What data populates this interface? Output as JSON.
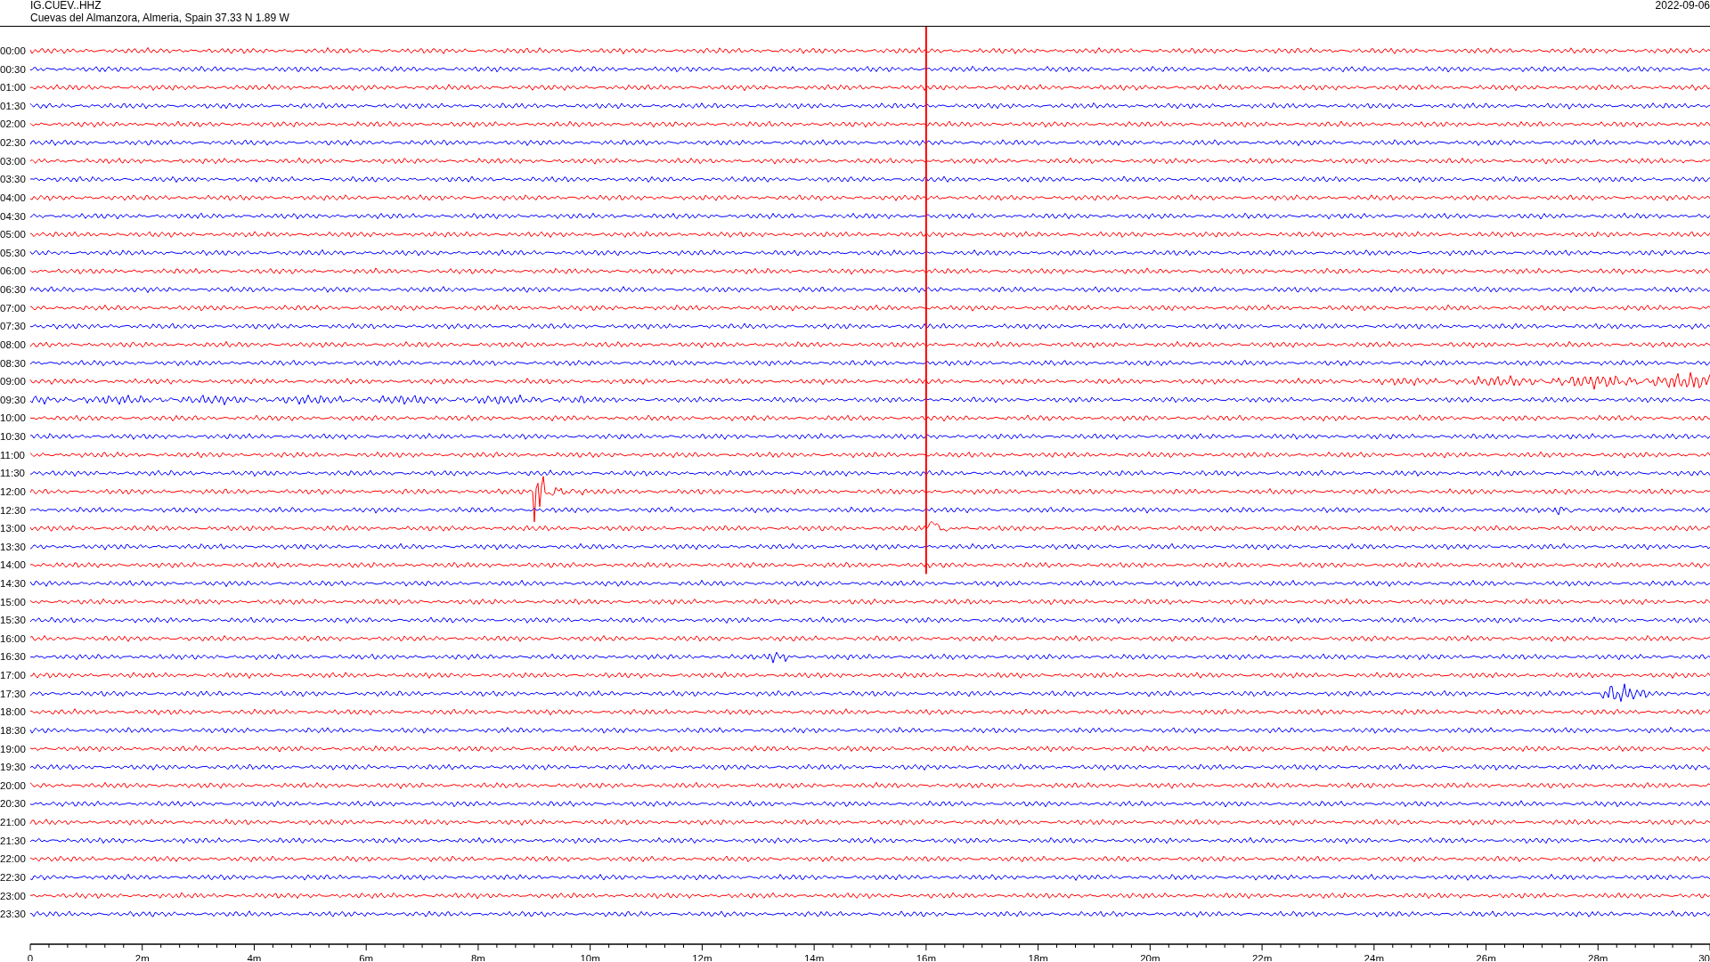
{
  "header": {
    "station": "IG.CUEV..HHZ",
    "location": "Cuevas del Almanzora, Almeria, Spain  37.33 N 1.89 W",
    "date": "2022-09-06"
  },
  "rows": [
    {
      "label": "00:00",
      "color": "#ff0000"
    },
    {
      "label": "00:30",
      "color": "#0000ff"
    },
    {
      "label": "01:00",
      "color": "#ff0000"
    },
    {
      "label": "01:30",
      "color": "#0000ff"
    },
    {
      "label": "02:00",
      "color": "#ff0000"
    },
    {
      "label": "02:30",
      "color": "#0000ff"
    },
    {
      "label": "03:00",
      "color": "#ff0000"
    },
    {
      "label": "03:30",
      "color": "#0000ff"
    },
    {
      "label": "04:00",
      "color": "#ff0000"
    },
    {
      "label": "04:30",
      "color": "#0000ff"
    },
    {
      "label": "05:00",
      "color": "#ff0000"
    },
    {
      "label": "05:30",
      "color": "#0000ff"
    },
    {
      "label": "06:00",
      "color": "#ff0000"
    },
    {
      "label": "06:30",
      "color": "#0000ff"
    },
    {
      "label": "07:00",
      "color": "#ff0000"
    },
    {
      "label": "07:30",
      "color": "#0000ff"
    },
    {
      "label": "08:00",
      "color": "#ff0000"
    },
    {
      "label": "08:30",
      "color": "#0000ff"
    },
    {
      "label": "09:00",
      "color": "#ff0000"
    },
    {
      "label": "09:30",
      "color": "#0000ff"
    },
    {
      "label": "10:00",
      "color": "#ff0000"
    },
    {
      "label": "10:30",
      "color": "#0000ff"
    },
    {
      "label": "11:00",
      "color": "#ff0000"
    },
    {
      "label": "11:30",
      "color": "#0000ff"
    },
    {
      "label": "12:00",
      "color": "#ff0000"
    },
    {
      "label": "12:30",
      "color": "#0000ff"
    },
    {
      "label": "13:00",
      "color": "#ff0000"
    },
    {
      "label": "13:30",
      "color": "#0000ff"
    },
    {
      "label": "14:00",
      "color": "#ff0000"
    },
    {
      "label": "14:30",
      "color": "#0000ff"
    },
    {
      "label": "15:00",
      "color": "#ff0000"
    },
    {
      "label": "15:30",
      "color": "#0000ff"
    },
    {
      "label": "16:00",
      "color": "#ff0000"
    },
    {
      "label": "16:30",
      "color": "#0000ff"
    },
    {
      "label": "17:00",
      "color": "#ff0000"
    },
    {
      "label": "17:30",
      "color": "#0000ff"
    },
    {
      "label": "18:00",
      "color": "#ff0000"
    },
    {
      "label": "18:30",
      "color": "#0000ff"
    },
    {
      "label": "19:00",
      "color": "#ff0000"
    },
    {
      "label": "19:30",
      "color": "#0000ff"
    },
    {
      "label": "20:00",
      "color": "#ff0000"
    },
    {
      "label": "20:30",
      "color": "#0000ff"
    },
    {
      "label": "21:00",
      "color": "#ff0000"
    },
    {
      "label": "21:30",
      "color": "#0000ff"
    },
    {
      "label": "22:00",
      "color": "#ff0000"
    },
    {
      "label": "22:30",
      "color": "#0000ff"
    },
    {
      "label": "23:00",
      "color": "#ff0000"
    },
    {
      "label": "23:30",
      "color": "#0000ff"
    }
  ],
  "axis": {
    "labels": [
      "0",
      "2m",
      "4m",
      "6m",
      "8m",
      "10m",
      "12m",
      "14m",
      "16m",
      "18m",
      "20m",
      "22m",
      "24m",
      "26m",
      "28m",
      "30"
    ]
  }
}
